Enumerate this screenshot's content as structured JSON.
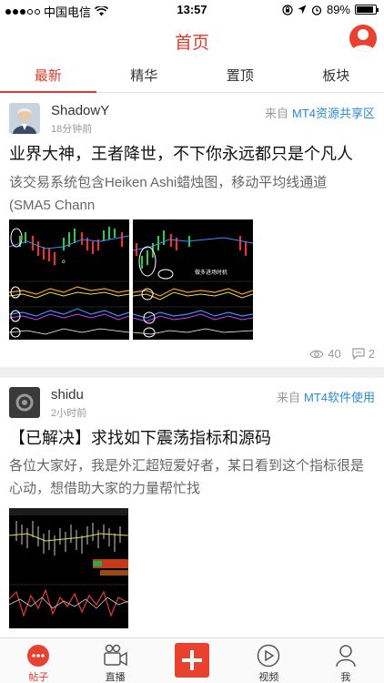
{
  "status_bar": {
    "carrier": "中国电信",
    "time": "13:57",
    "battery": "89%",
    "battery_level": 0.89
  },
  "header": {
    "title": "首页"
  },
  "tabs": [
    {
      "label": "最新",
      "active": true
    },
    {
      "label": "精华",
      "active": false
    },
    {
      "label": "置顶",
      "active": false
    },
    {
      "label": "板块",
      "active": false
    }
  ],
  "posts": [
    {
      "author": "ShadowY",
      "time": "18分钟前",
      "source_prefix": "来自",
      "source": "MT4资源共享区",
      "title": "业界大神，王者降世，不下你永远都只是个凡人",
      "excerpt_line1": "该交易系统包含Heiken Ashi蜡烛图，移动平均线通道",
      "excerpt_line2": "(SMA5 Chann",
      "chart_annotation": "做多进场时机",
      "views": "40",
      "comments": "2"
    },
    {
      "author": "shidu",
      "time": "2小时前",
      "source_prefix": "来自",
      "source": "MT4软件使用",
      "title": "【已解决】求找如下震荡指标和源码",
      "excerpt_line1": "各位大家好，我是外汇超短爱好者，某日看到这个指标很是",
      "excerpt_line2": "心动，想借助大家的力量帮忙找"
    }
  ],
  "bottom_nav": [
    {
      "label": "帖子",
      "icon": "chat-bubble-icon",
      "active": true
    },
    {
      "label": "直播",
      "icon": "video-camera-icon",
      "active": false
    },
    {
      "label": "",
      "icon": "plus-icon",
      "active": false
    },
    {
      "label": "视频",
      "icon": "play-circle-icon",
      "active": false
    },
    {
      "label": "我",
      "icon": "person-icon",
      "active": false
    }
  ],
  "colors": {
    "accent": "#e03a2e",
    "link": "#2a8bd6"
  }
}
